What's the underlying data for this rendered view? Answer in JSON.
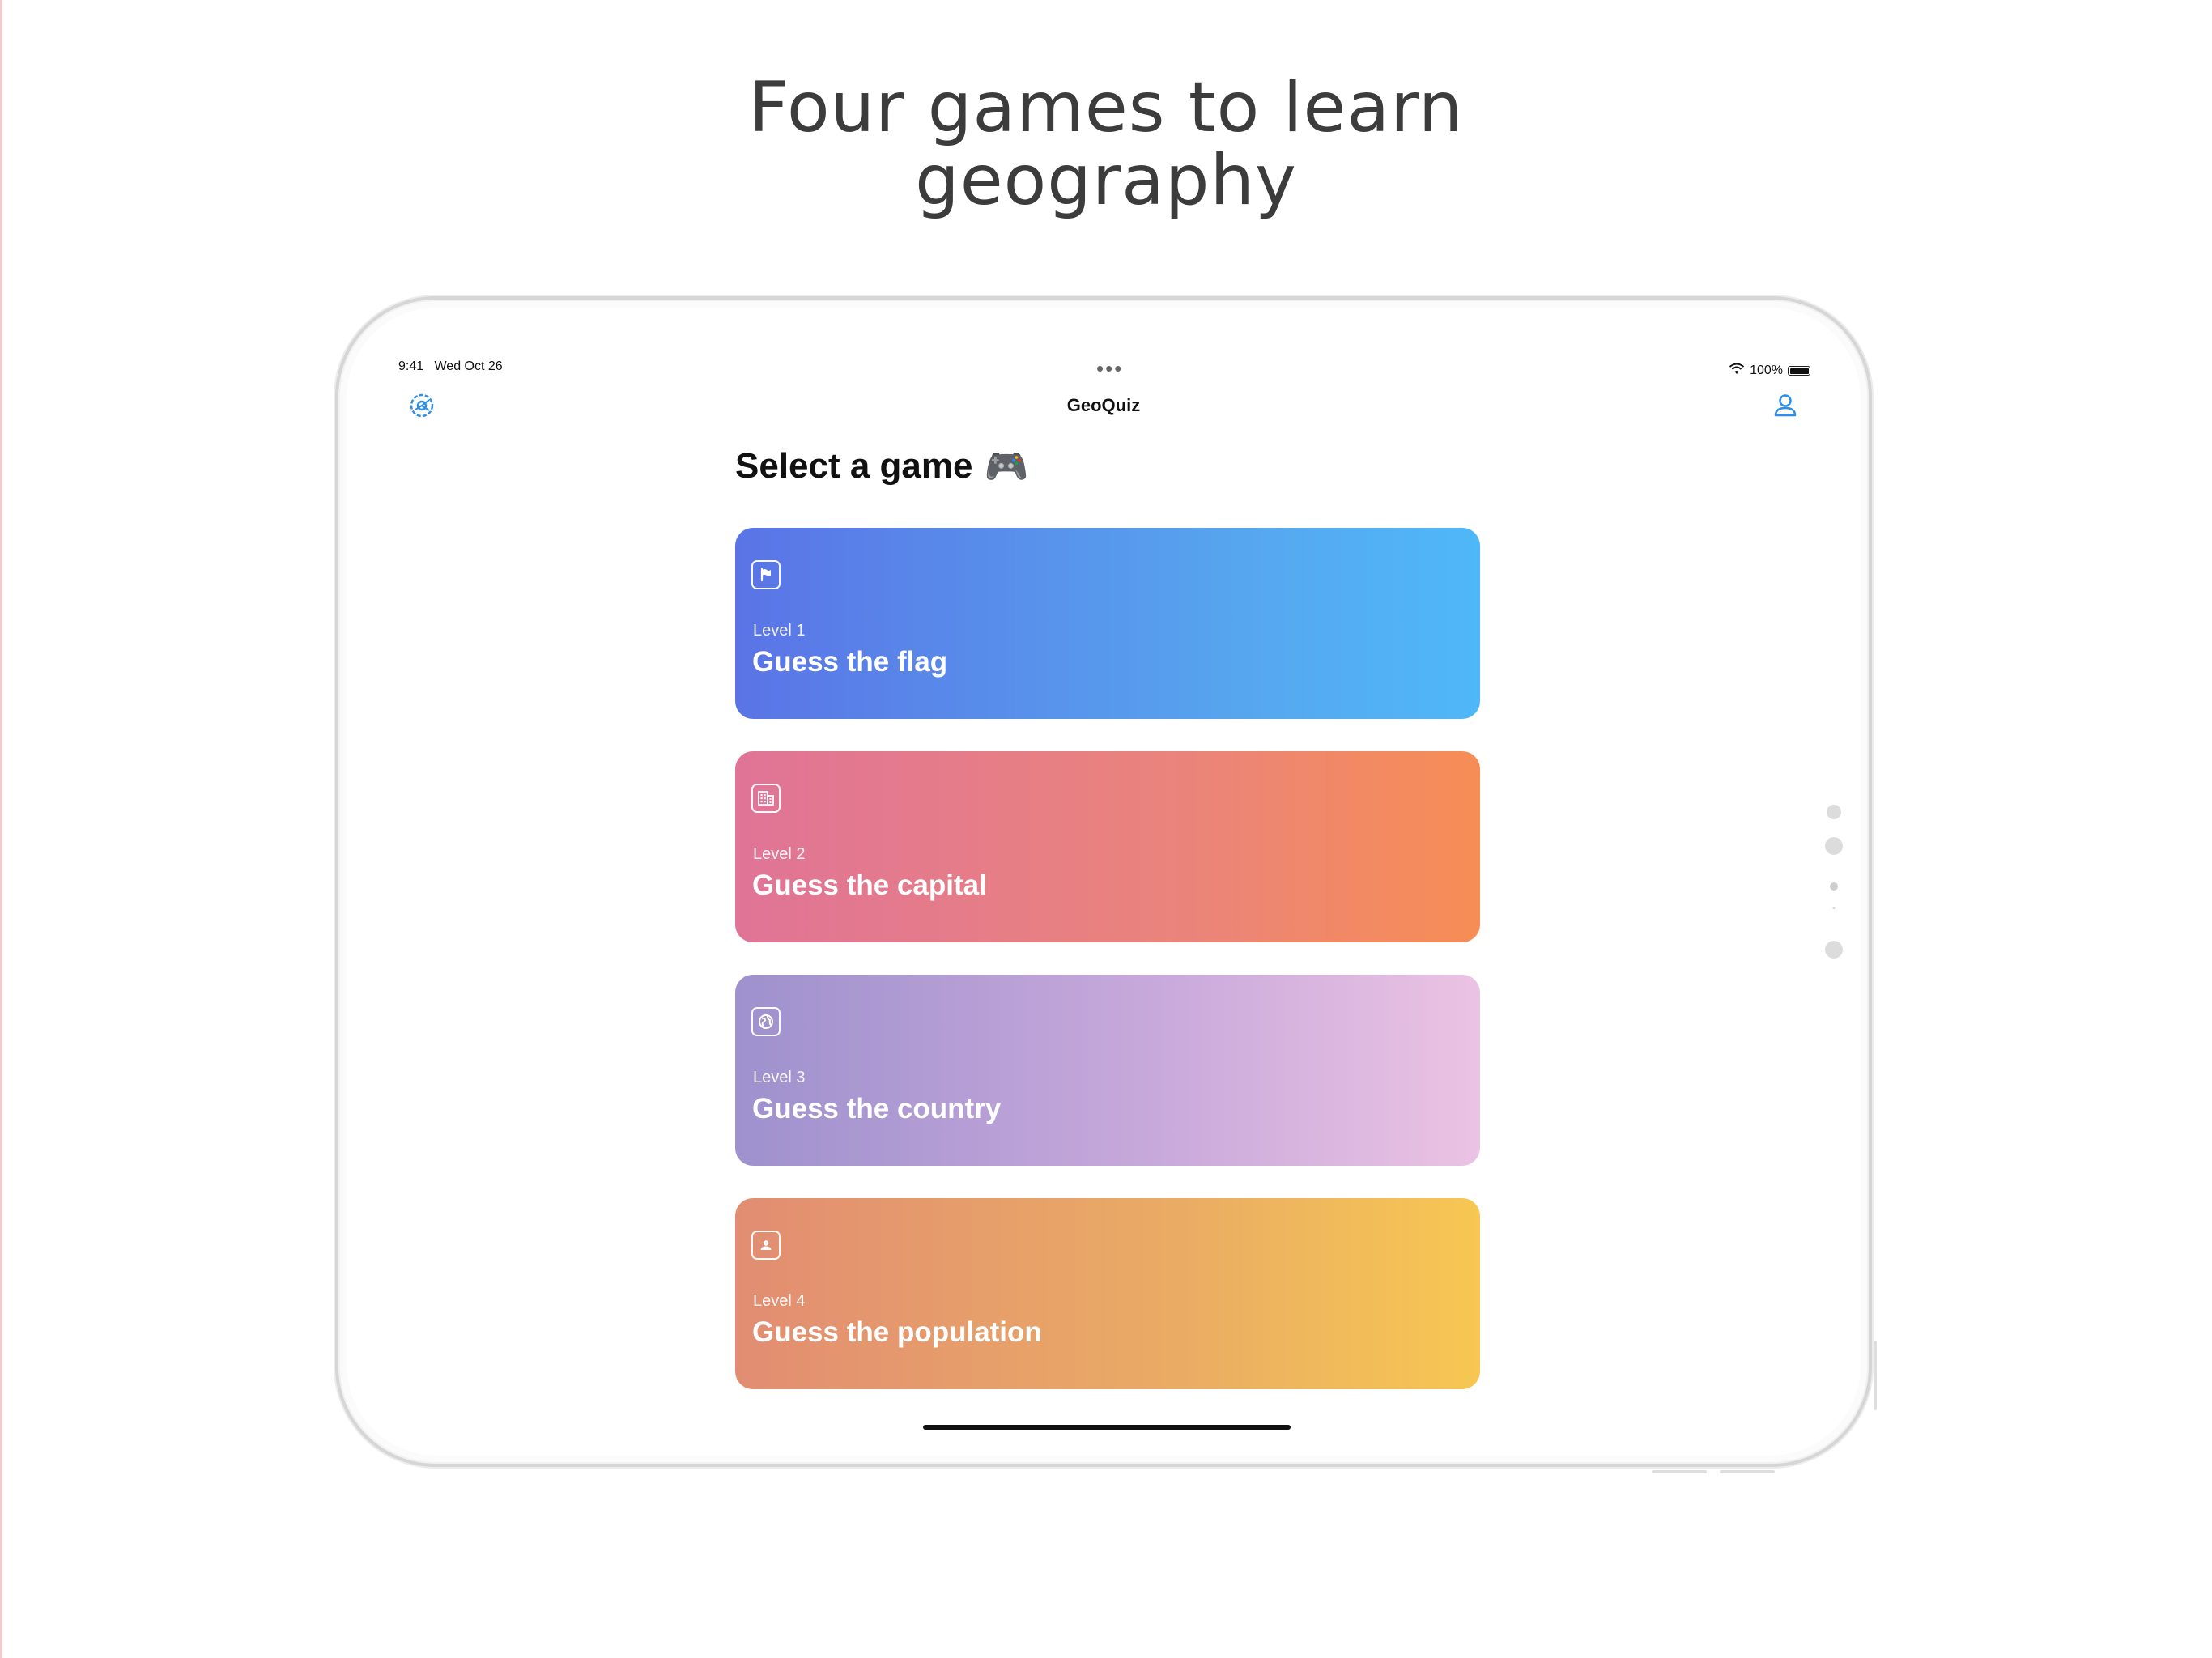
{
  "headline": {
    "line1": "Four games to learn",
    "line2": "geography"
  },
  "status_bar": {
    "time": "9:41",
    "date": "Wed Oct 26",
    "battery": "100%",
    "multitask_dots": "•••"
  },
  "nav": {
    "title": "GeoQuiz",
    "left_icon": "gear-icon",
    "right_icon": "person-icon"
  },
  "section": {
    "title": "Select a game",
    "emoji": "🎮"
  },
  "games": [
    {
      "level": "Level 1",
      "name": "Guess the flag",
      "icon": "flag-icon",
      "colors": [
        "#5a74e6",
        "#4fb8f8"
      ]
    },
    {
      "level": "Level 2",
      "name": "Guess the capital",
      "icon": "building-icon",
      "colors": [
        "#e07497",
        "#f78d55"
      ]
    },
    {
      "level": "Level 3",
      "name": "Guess the country",
      "icon": "globe-icon",
      "colors": [
        "#9e91cd",
        "#ebc3e3"
      ]
    },
    {
      "level": "Level 4",
      "name": "Guess the population",
      "icon": "person-card-icon",
      "colors": [
        "#e28d72",
        "#f7c752"
      ]
    }
  ],
  "accent_color": "#2f8ee8"
}
